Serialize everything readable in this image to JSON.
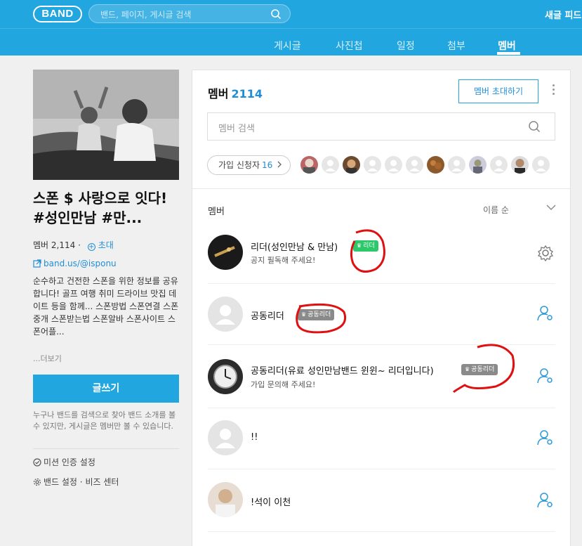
{
  "header": {
    "logo": "BAND",
    "search_placeholder": "밴드, 페이지, 게시글 검색",
    "right_text": "새글 피드"
  },
  "nav": {
    "tabs": [
      {
        "label": "게시글",
        "active": false
      },
      {
        "label": "사진첩",
        "active": false
      },
      {
        "label": "일정",
        "active": false
      },
      {
        "label": "첨부",
        "active": false
      },
      {
        "label": "멤버",
        "active": true
      }
    ]
  },
  "band": {
    "title": "스폰 $ 사랑으로 잇다! #성인만남 #만...",
    "members": "멤버 2,114",
    "invite": "초대",
    "url": "band.us/@isponu",
    "description": "순수하고 건전한 스폰을 위한 정보를 공유합니다! 골프 여행 취미 드라이브 맛집 데이트 등을 함께... 스폰방법 스폰연결 스폰중개 스폰받는법 스폰알바 스폰사이트 스폰어플...",
    "more": "...더보기",
    "write_button": "글쓰기",
    "notice": "누구나 밴드를 검색으로 찾아 밴드 소개를 볼 수 있지만, 게시글은 멤버만 볼 수 있습니다.",
    "mission_setting": "미션 인증 설정",
    "band_setting": "밴드 설정",
    "biz_center": "비즈 센터"
  },
  "members_panel": {
    "title": "멤버",
    "count": "2114",
    "invite_button": "멤버 초대하기",
    "search_placeholder": "멤버 검색",
    "applicants_label": "가입 신청자",
    "applicants_count": "16",
    "list_header": "멤버",
    "sort_label": "이름 순",
    "members": [
      {
        "name": "리더(성인만남 & 만남)",
        "badge": "리더",
        "role": "leader",
        "status": "공지 필독해 주세요!"
      },
      {
        "name": "공동리더",
        "badge": "공동리더",
        "role": "coleader",
        "status": ""
      },
      {
        "name": "공동리더(유료 성인만남밴드 윈윈~ 리더입니다)",
        "badge": "공동리더",
        "role": "coleader",
        "status": "가입 문의해 주세요!"
      },
      {
        "name": "!!",
        "badge": "",
        "role": "member",
        "status": ""
      },
      {
        "name": "!석이 이천",
        "badge": "",
        "role": "member",
        "status": ""
      }
    ]
  },
  "colors": {
    "brand_blue": "#22a6e0",
    "link_blue": "#1f8ed6",
    "leader_green": "#2cc86a",
    "coleader_gray": "#8a8a8a",
    "annotation_red": "#e01010"
  },
  "icons": [
    "search-icon",
    "plus-circle-icon",
    "external-link-icon",
    "check-circle-icon",
    "gear-icon",
    "chevron-down-icon",
    "chevron-right-icon",
    "crown-icon",
    "member-setting-icon",
    "more-vertical-icon"
  ]
}
